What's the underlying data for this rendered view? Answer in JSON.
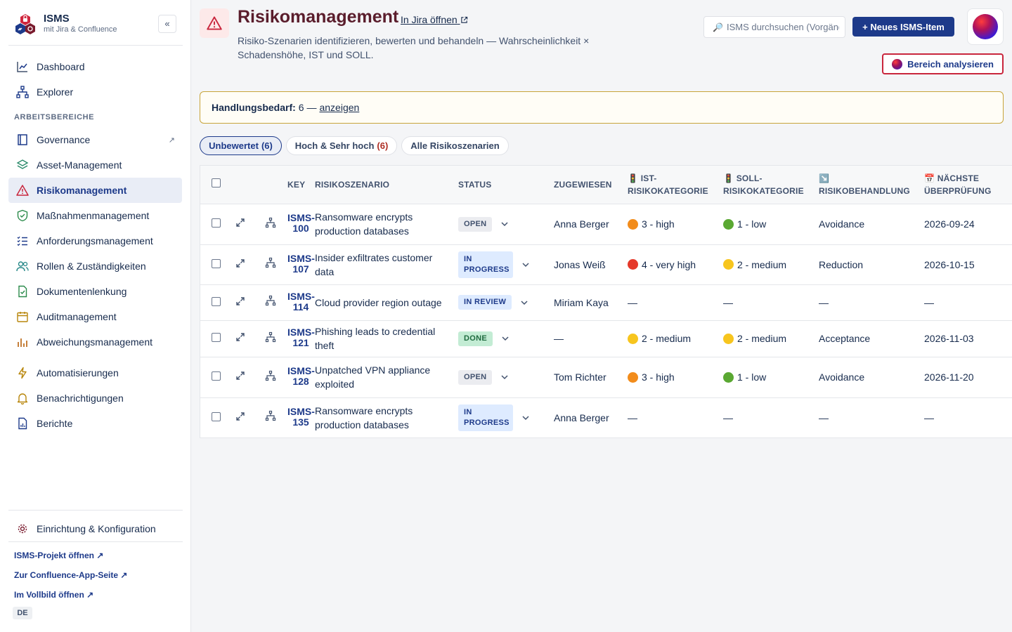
{
  "sidebar": {
    "brand": {
      "name": "ISMS",
      "subtitle": "mit Jira & Confluence"
    },
    "collapse_label": "«",
    "top_items": [
      {
        "label": "Dashboard",
        "icon": "chart-line-icon"
      },
      {
        "label": "Explorer",
        "icon": "hierarchy-icon"
      }
    ],
    "section_title": "ARBEITSBEREICHE",
    "items": [
      {
        "label": "Governance",
        "icon": "book-icon",
        "external": "↗"
      },
      {
        "label": "Asset-Management",
        "icon": "layers-icon"
      },
      {
        "label": "Risikomanagement",
        "icon": "warning-icon",
        "active": true
      },
      {
        "label": "Maßnahmenmanagement",
        "icon": "shield-check-icon"
      },
      {
        "label": "Anforderungsmanagement",
        "icon": "checklist-icon"
      },
      {
        "label": "Rollen & Zuständigkeiten",
        "icon": "users-icon"
      },
      {
        "label": "Dokumentenlenkung",
        "icon": "document-check-icon"
      },
      {
        "label": "Auditmanagement",
        "icon": "calendar-icon"
      },
      {
        "label": "Abweichungsmanagement",
        "icon": "bar-chart-icon"
      }
    ],
    "tools": [
      {
        "label": "Automatisierungen",
        "icon": "lightning-icon"
      },
      {
        "label": "Benachrichtigungen",
        "icon": "bell-icon"
      },
      {
        "label": "Berichte",
        "icon": "report-icon"
      }
    ],
    "settings": {
      "label": "Einrichtung & Konfiguration",
      "icon": "cog-icon"
    },
    "footer_links": [
      "ISMS-Projekt öffnen ↗",
      "Zur Confluence-App-Seite ↗",
      "Im Vollbild öffnen ↗"
    ],
    "language": "DE"
  },
  "header": {
    "title": "Risikomanagement",
    "jira_link": "In Jira öffnen",
    "description": "Risiko-Szenarien identifizieren, bewerten und behandeln — Wahrscheinlichkeit × Schadenshöhe, IST und SOLL.",
    "search_placeholder": "ISMS durchsuchen (Vorgänge, Seiten…)",
    "new_button": "+ Neues ISMS-Item",
    "analyze_button": "Bereich analysieren"
  },
  "banner": {
    "label": "Handlungsbedarf:",
    "count": "6 —",
    "link": "anzeigen"
  },
  "filters": [
    {
      "label": "Unbewertet",
      "count": "(6)",
      "active": true
    },
    {
      "label": "Hoch & Sehr hoch",
      "count": "(6)",
      "count_red": true
    },
    {
      "label": "Alle Risikoszenarien"
    }
  ],
  "table": {
    "columns": {
      "key": "KEY",
      "scenario": "RISIKOSZENARIO",
      "status": "STATUS",
      "assigned": "ZUGEWIESEN",
      "ist_icon": "🚦",
      "ist": "IST-RISIKOKATEGORIE",
      "soll_icon": "🚦",
      "soll": "SOLL-RISIKOKATEGORIE",
      "treatment_icon": "↘️",
      "treatment": "RISIKOBEHANDLUNG",
      "next_icon": "📅",
      "next": "NÄCHSTE ÜBERPRÜFUNG"
    },
    "rows": [
      {
        "key": "ISMS-100",
        "scenario": "Ransomware encrypts production databases",
        "status": "OPEN",
        "status_type": "open",
        "assigned": "Anna Berger",
        "ist": "3 - high",
        "ist_color": "#f28c1b",
        "soll": "1 - low",
        "soll_color": "#5aa832",
        "treatment": "Avoidance",
        "next": "2026-09-24"
      },
      {
        "key": "ISMS-107",
        "scenario": "Insider exfiltrates customer data",
        "status": "IN PROGRESS",
        "status_type": "progress",
        "assigned": "Jonas Weiß",
        "ist": "4 - very high",
        "ist_color": "#e5392a",
        "soll": "2 - medium",
        "soll_color": "#f7c51e",
        "treatment": "Reduction",
        "next": "2026-10-15"
      },
      {
        "key": "ISMS-114",
        "scenario": "Cloud provider region outage",
        "status": "IN REVIEW",
        "status_type": "review",
        "assigned": "Miriam Kaya",
        "ist": "—",
        "ist_color": "",
        "soll": "—",
        "soll_color": "",
        "treatment": "—",
        "next": "—"
      },
      {
        "key": "ISMS-121",
        "scenario": "Phishing leads to credential theft",
        "status": "DONE",
        "status_type": "done",
        "assigned": "—",
        "ist": "2 - medium",
        "ist_color": "#f7c51e",
        "soll": "2 - medium",
        "soll_color": "#f7c51e",
        "treatment": "Acceptance",
        "next": "2026-11-03"
      },
      {
        "key": "ISMS-128",
        "scenario": "Unpatched VPN appliance exploited",
        "status": "OPEN",
        "status_type": "open",
        "assigned": "Tom Richter",
        "ist": "3 - high",
        "ist_color": "#f28c1b",
        "soll": "1 - low",
        "soll_color": "#5aa832",
        "treatment": "Avoidance",
        "next": "2026-11-20"
      },
      {
        "key": "ISMS-135",
        "scenario": "Ransomware encrypts production databases",
        "status": "IN PROGRESS",
        "status_type": "progress",
        "assigned": "Anna Berger",
        "ist": "—",
        "ist_color": "",
        "soll": "—",
        "soll_color": "",
        "treatment": "—",
        "next": "—"
      }
    ]
  }
}
